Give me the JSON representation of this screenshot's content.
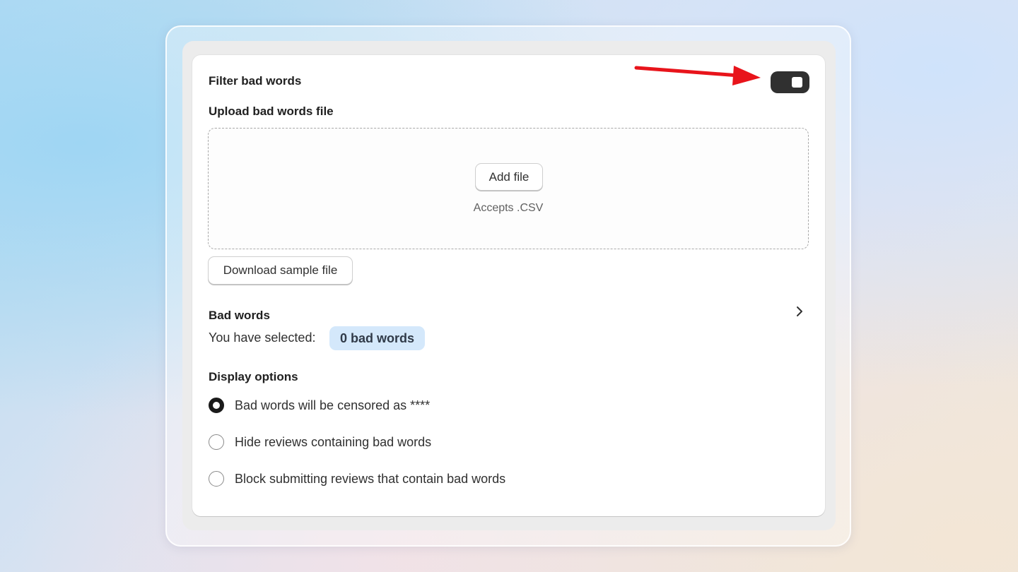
{
  "settings_card": {
    "filter_title": "Filter bad words",
    "filter_toggle_on": true,
    "upload_title": "Upload bad words file",
    "add_file_label": "Add file",
    "accepts_text": "Accepts .CSV",
    "download_sample_label": "Download sample file",
    "bad_words_title": "Bad words",
    "selected_prefix": "You have selected:",
    "selected_badge": "0 bad words",
    "display_options_title": "Display options",
    "display_options": [
      {
        "label": "Bad words will be censored as ****",
        "checked": true
      },
      {
        "label": "Hide reviews containing bad words",
        "checked": false
      },
      {
        "label": "Block submitting reviews that contain bad words",
        "checked": false
      }
    ]
  },
  "annotation": {
    "arrow_color": "#e8141b"
  },
  "icons": {
    "chevron": "chevron-right-icon"
  }
}
